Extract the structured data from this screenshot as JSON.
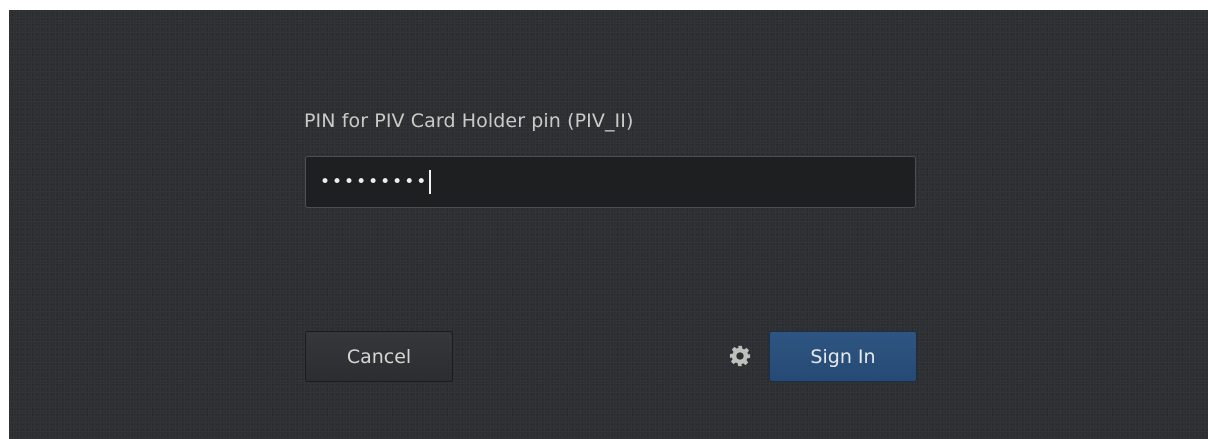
{
  "dialog": {
    "prompt_label": "PIN for PIV Card Holder pin (PIV_II)",
    "pin_field": {
      "masked_value": "•••••••••",
      "type": "password"
    },
    "cancel_label": "Cancel",
    "signin_label": "Sign In",
    "session_options_icon": "gear-icon"
  },
  "colors": {
    "background": "#2d2f32",
    "field_background": "#1e1f21",
    "accent_button": "#2a5079",
    "text": "#c9cbc6"
  }
}
